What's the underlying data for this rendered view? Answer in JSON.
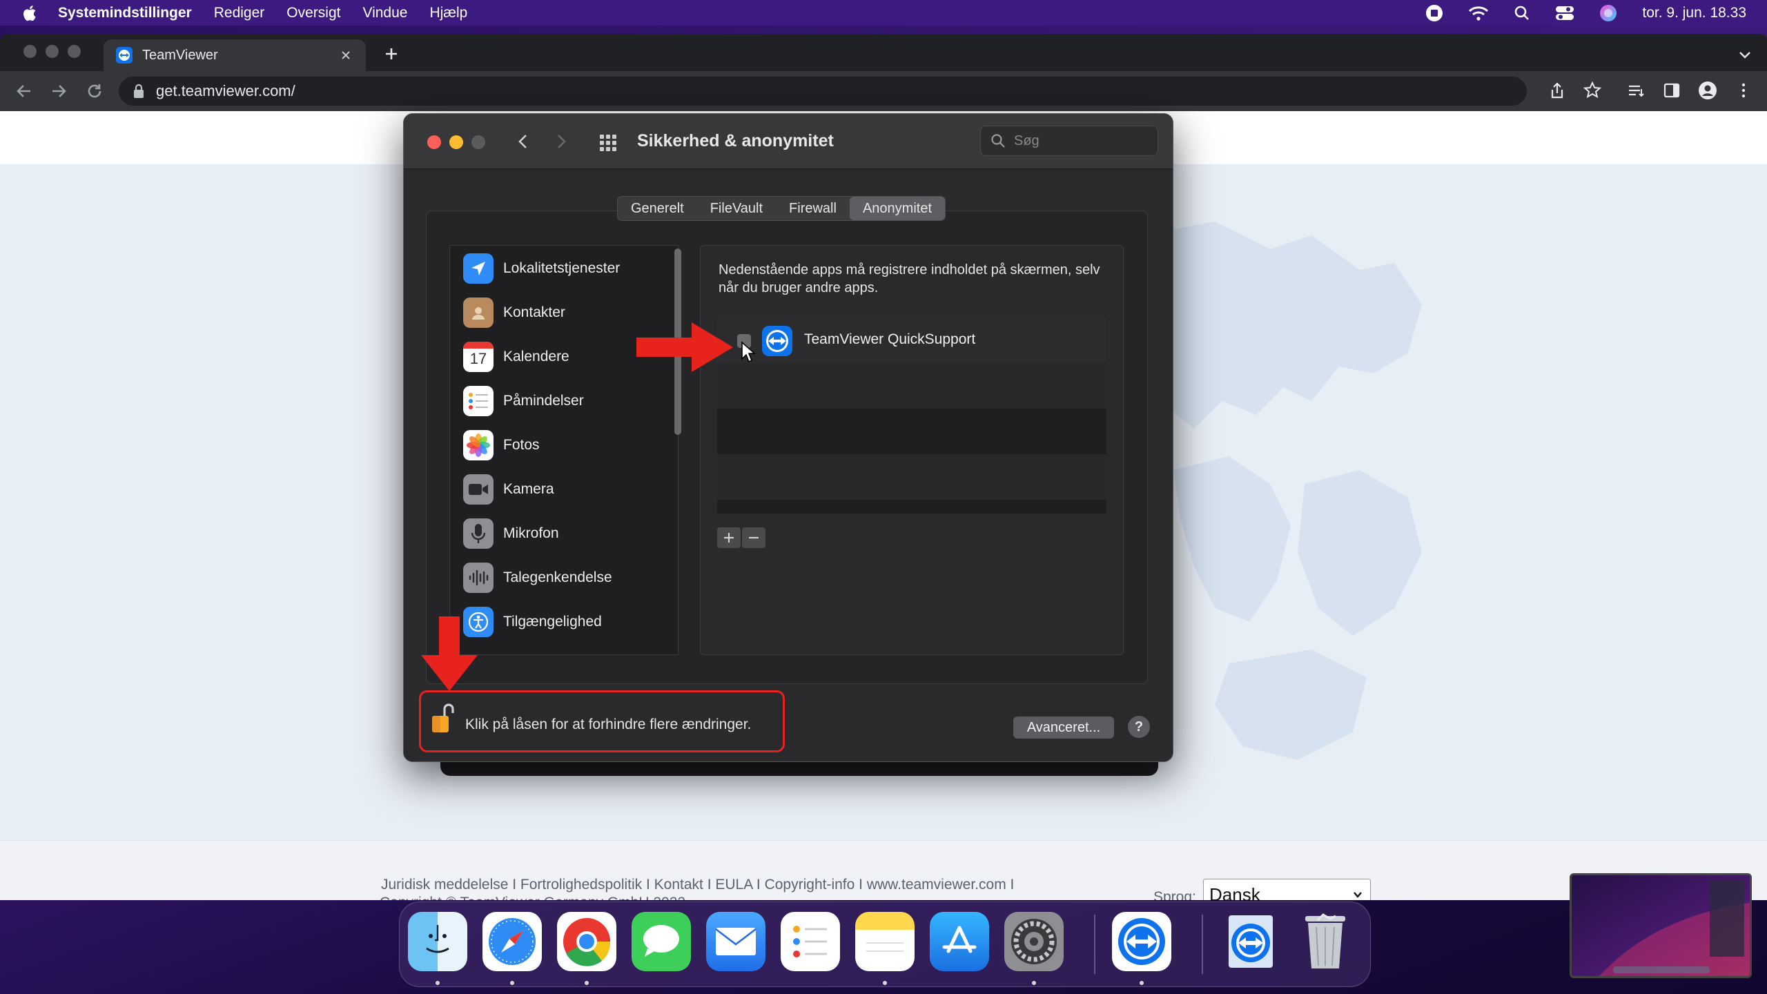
{
  "menubar": {
    "app_name": "Systemindstillinger",
    "items": [
      "Rediger",
      "Oversigt",
      "Vindue",
      "Hjælp"
    ],
    "datetime": "tor. 9. jun. 18.33"
  },
  "browser": {
    "tab_title": "TeamViewer",
    "url": "get.teamviewer.com/"
  },
  "prefs": {
    "title": "Sikkerhed & anonymitet",
    "search_placeholder": "Søg",
    "tabs": [
      "Generelt",
      "FileVault",
      "Firewall",
      "Anonymitet"
    ],
    "active_tab": "Anonymitet",
    "sidebar": [
      {
        "label": "Lokalitetstjenester",
        "icon": "location-arrow-icon"
      },
      {
        "label": "Kontakter",
        "icon": "contacts-icon"
      },
      {
        "label": "Kalendere",
        "icon": "calendar-icon",
        "badge": "17"
      },
      {
        "label": "Påmindelser",
        "icon": "reminders-icon"
      },
      {
        "label": "Fotos",
        "icon": "photos-icon"
      },
      {
        "label": "Kamera",
        "icon": "camera-icon"
      },
      {
        "label": "Mikrofon",
        "icon": "microphone-icon"
      },
      {
        "label": "Talegenkendelse",
        "icon": "waveform-icon"
      },
      {
        "label": "Tilgængelighed",
        "icon": "accessibility-icon"
      }
    ],
    "description": "Nedenstående apps må registrere indholdet på skærmen, selv når du bruger andre apps.",
    "apps": [
      {
        "name": "TeamViewer QuickSupport",
        "checked": false
      }
    ],
    "lock_text": "Klik på låsen for at forhindre flere ændringer.",
    "advanced_label": "Avanceret...",
    "help_label": "?"
  },
  "footer": {
    "links": "Juridisk meddelelse  I  Fortrolighedspolitik  I  Kontakt  I  EULA  I  Copyright-info  I  www.teamviewer.com I",
    "copyright": "Copyright © TeamViewer Germany GmbH 2022",
    "language_label": "Sprog:",
    "language_value": "Dansk"
  },
  "dock": [
    "Finder",
    "Safari",
    "Chrome",
    "Beskeder",
    "Mail",
    "Påmindelser",
    "Noter",
    "App Store",
    "Systemindstillinger",
    "TeamViewer QuickSupport",
    "TeamViewer",
    "Papirkurv"
  ],
  "colors": {
    "menubar": "#3c1a80",
    "highlight_red": "#e8231e",
    "teamviewer_blue": "#0e72ed"
  }
}
